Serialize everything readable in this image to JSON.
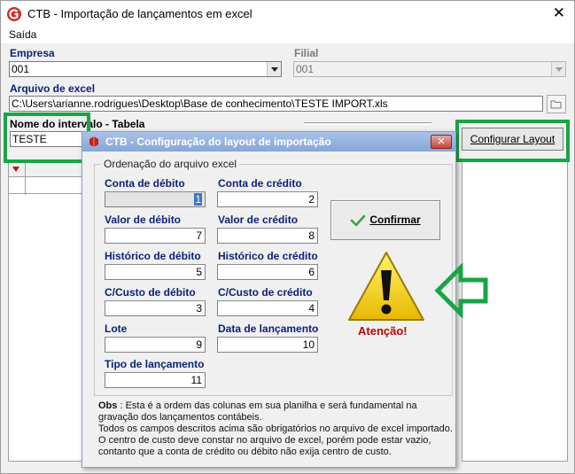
{
  "window": {
    "title": "CTB - Importação de lançamentos em excel",
    "close_glyph": "✕",
    "menu": [
      {
        "label": "Saída"
      }
    ]
  },
  "form": {
    "empresa_label": "Empresa",
    "empresa_value": "001",
    "filial_label": "Filial",
    "filial_value": "001",
    "arquivo_label": "Arquivo de excel",
    "arquivo_value": "C:\\Users\\arianne.rodrigues\\Desktop\\Base de conhecimento\\TESTE IMPORT.xls",
    "intervalo_label": "Nome do intervalo - Tabela",
    "intervalo_value": "TESTE",
    "configurar_button": "Configurar Layout"
  },
  "dialog": {
    "title": "CTB - Configuração do layout de importação",
    "close_glyph": "✕",
    "group_title": "Ordenação do arquivo excel",
    "fields": {
      "conta_debito": {
        "label": "Conta de débito",
        "value": "1"
      },
      "conta_credito": {
        "label": "Conta de crédito",
        "value": "2"
      },
      "valor_debito": {
        "label": "Valor de débito",
        "value": "7"
      },
      "valor_credito": {
        "label": "Valor de crédito",
        "value": "8"
      },
      "historico_debito": {
        "label": "Histórico de débito",
        "value": "5"
      },
      "historico_credito": {
        "label": "Histórico de crédito",
        "value": "6"
      },
      "custo_debito": {
        "label": "C/Custo de débito",
        "value": "3"
      },
      "custo_credito": {
        "label": "C/Custo de crédito",
        "value": "4"
      },
      "lote": {
        "label": "Lote",
        "value": "9"
      },
      "data_lancamento": {
        "label": "Data de lançamento",
        "value": "10"
      },
      "tipo_lancamento": {
        "label": "Tipo de lançamento",
        "value": "11"
      }
    },
    "confirm_button": "Confirmar",
    "warning_text": "Atenção!",
    "obs_label": "Obs",
    "obs_text": ": Esta é a ordem das colunas em sua planilha e será fundamental na gravação dos lançamentos contábeis.",
    "obs_line2": "Todos os campos descritos acima são obrigatórios no arquivo de excel importado.",
    "obs_line3": "O centro de custo deve constar no arquivo de excel, porém pode estar vazio, contanto que a conta de crédito ou débito não exija centro de custo."
  },
  "colors": {
    "label_blue": "#0d2277",
    "highlight_green": "#19a447",
    "warning_red": "#c10000",
    "dialog_title": "#85a6d9"
  },
  "icons": [
    "app-logo-icon",
    "close-icon",
    "chevron-down-icon",
    "folder-icon",
    "dialog-app-icon",
    "checkmark-icon",
    "warning-icon",
    "arrow-left-icon"
  ]
}
